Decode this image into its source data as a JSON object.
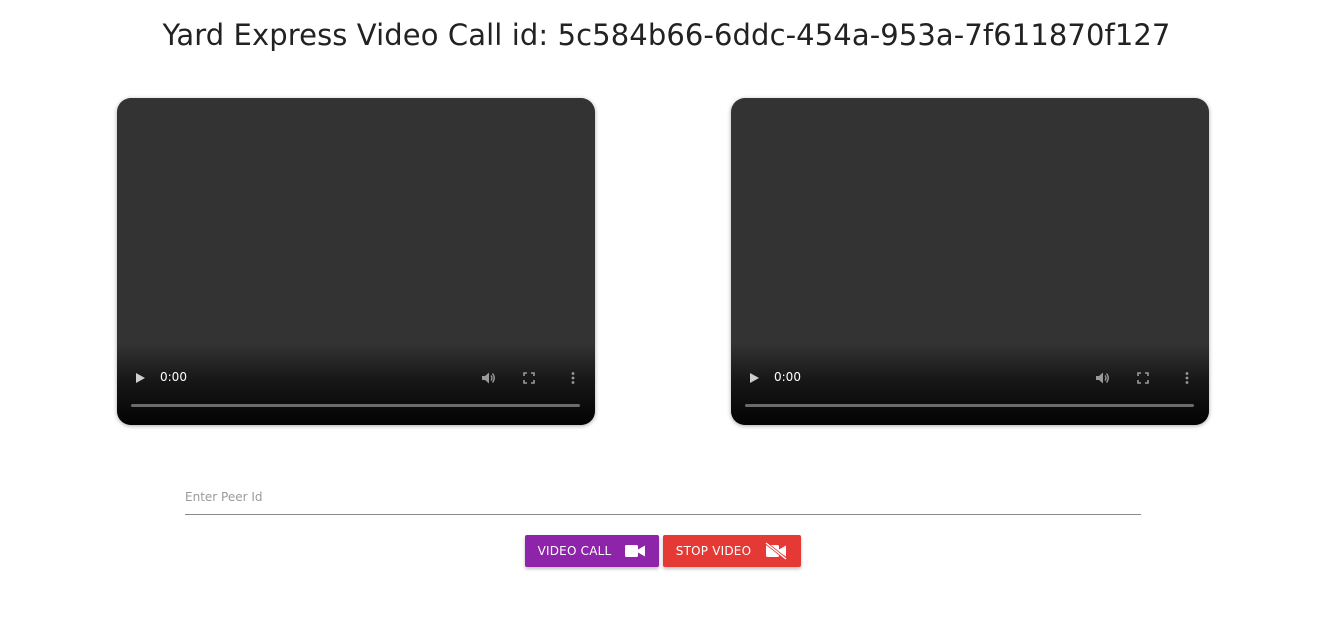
{
  "header": {
    "title": "Yard Express Video Call id: 5c584b66-6ddc-454a-953a-7f611870f127"
  },
  "videos": [
    {
      "name": "local-video",
      "time": "0:00",
      "icons": [
        "play-icon",
        "volume-icon",
        "fullscreen-icon",
        "more-vert-icon"
      ]
    },
    {
      "name": "remote-video",
      "time": "0:00",
      "icons": [
        "play-icon",
        "volume-icon",
        "fullscreen-icon",
        "more-vert-icon"
      ]
    }
  ],
  "peer_input": {
    "placeholder": "Enter Peer Id",
    "value": ""
  },
  "buttons": {
    "video_call": {
      "label": "VIDEO CALL",
      "icon": "videocam-icon",
      "color": "#8e24aa"
    },
    "stop_video": {
      "label": "STOP VIDEO",
      "icon": "videocam-off-icon",
      "color": "#e53935"
    }
  }
}
